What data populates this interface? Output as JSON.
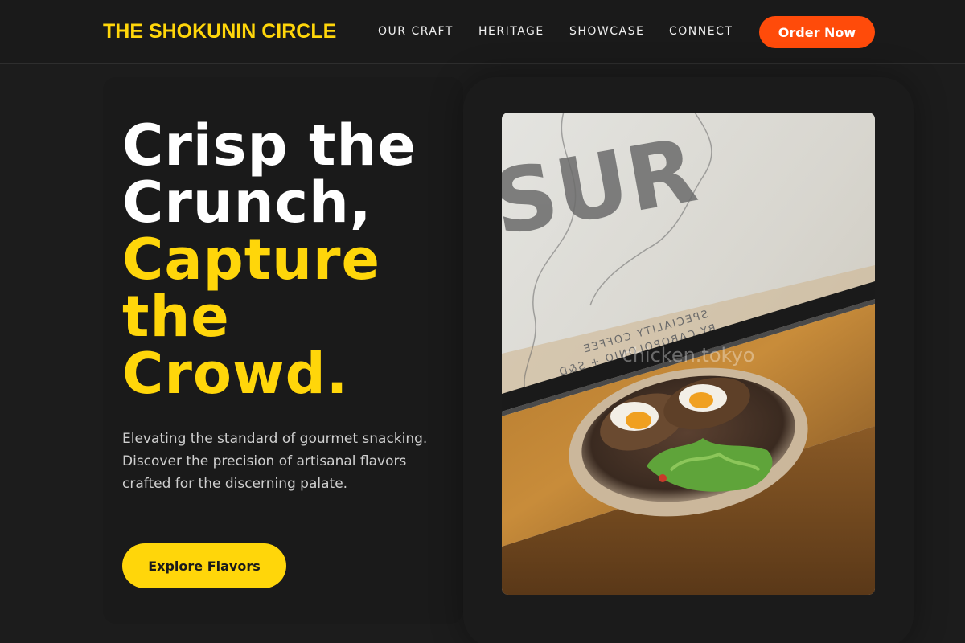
{
  "header": {
    "brand": "THE SHOKUNIN CIRCLE",
    "nav": [
      "OUR CRAFT",
      "HERITAGE",
      "SHOWCASE",
      "CONNECT"
    ],
    "order_label": "Order Now"
  },
  "hero": {
    "headline_line1": "Crisp the",
    "headline_line2": "Crunch,",
    "headline_accent1": "Capture",
    "headline_accent2": "the",
    "headline_accent3": "Crowd.",
    "subtitle": "Elevating the standard of gourmet snacking. Discover the precision of artisanal flavors crafted for the discerning palate.",
    "cta_label": "Explore Flavors"
  },
  "photo": {
    "window_text_large": "SUR",
    "window_text_line1": "SPECIALITY COFFEE",
    "window_text_line2": "BY CABOPOLONIO + S&D",
    "watermark": "chicken.tokyo"
  },
  "colors": {
    "accent_yellow": "#ffd60a",
    "accent_orange": "#ff4b0a",
    "background": "#1c1c1c"
  }
}
